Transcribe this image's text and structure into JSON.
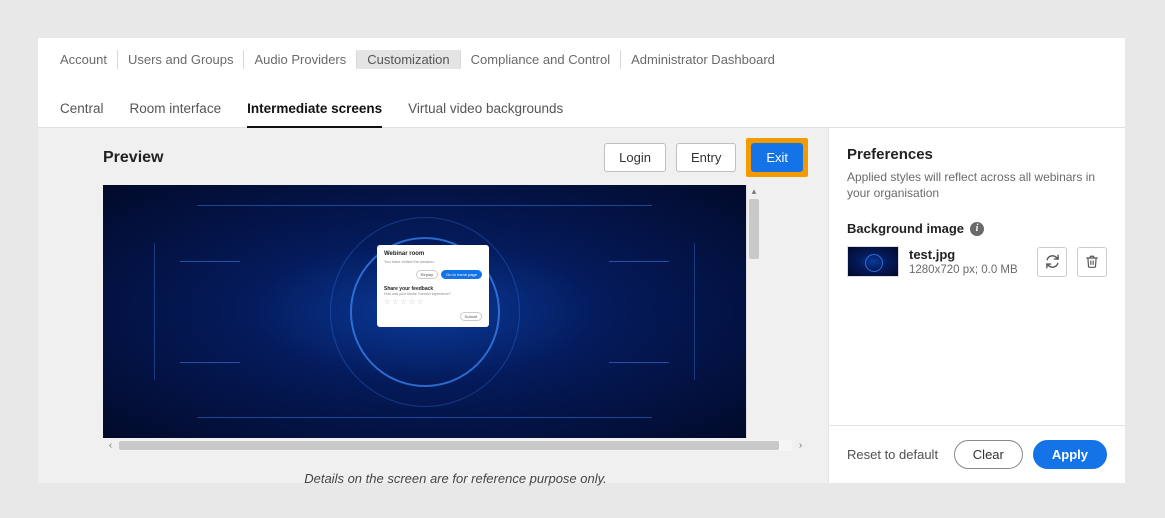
{
  "topnav": {
    "items": [
      {
        "label": "Account"
      },
      {
        "label": "Users and Groups"
      },
      {
        "label": "Audio Providers"
      },
      {
        "label": "Customization"
      },
      {
        "label": "Compliance and Control"
      },
      {
        "label": "Administrator Dashboard"
      }
    ]
  },
  "subtabs": {
    "items": [
      {
        "label": "Central"
      },
      {
        "label": "Room interface"
      },
      {
        "label": "Intermediate screens"
      },
      {
        "label": "Virtual video backgrounds"
      }
    ]
  },
  "preview": {
    "title": "Preview",
    "buttons": {
      "login": "Login",
      "entry": "Entry",
      "exit": "Exit"
    },
    "dialog": {
      "heading": "Webinar room",
      "subtext": "You have exited the session.",
      "replay": "Replay",
      "gohome": "Go to home page",
      "feedback_title": "Share your feedback",
      "feedback_sub": "How was your Adobe Connect experience?",
      "submit": "Submit"
    },
    "footnote": "Details on the screen are for reference purpose only."
  },
  "prefs": {
    "title": "Preferences",
    "desc": "Applied styles will reflect across all webinars in your organisation",
    "bg_label": "Background image",
    "file": {
      "name": "test.jpg",
      "meta": "1280x720 px; 0.0 MB"
    }
  },
  "footer": {
    "reset": "Reset to default",
    "clear": "Clear",
    "apply": "Apply"
  }
}
